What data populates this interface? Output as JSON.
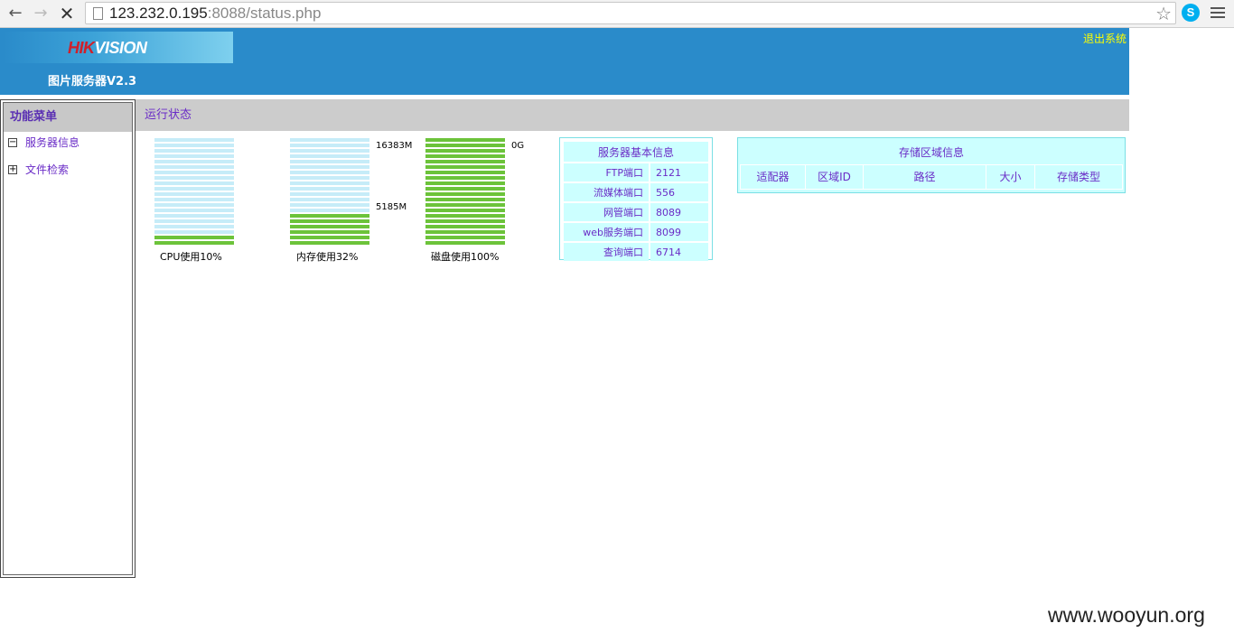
{
  "browser": {
    "url_host": "123.232.0.195",
    "url_port_path": ":8088/status.php"
  },
  "header": {
    "logo_text_hik": "HIK",
    "logo_text_rest": "VISION",
    "app_title": "图片服务器V2.3",
    "logout_label": "退出系统"
  },
  "sidebar": {
    "title": "功能菜单",
    "items": [
      {
        "label": "服务器信息",
        "toggle": "−"
      },
      {
        "label": "文件检索",
        "toggle": "+"
      }
    ]
  },
  "content": {
    "section_title": "运行状态"
  },
  "gauges": {
    "cpu": {
      "label": "CPU使用10%",
      "fraction": 0.1
    },
    "memory": {
      "label": "内存使用32%",
      "fraction": 0.32,
      "total": "16383M",
      "used": "5185M"
    },
    "disk": {
      "label": "磁盘使用100%",
      "fraction": 1.0,
      "total": "0G"
    },
    "colors": {
      "empty": "#c6ecf8",
      "filled": "#6cc33a"
    }
  },
  "server_info": {
    "title": "服务器基本信息",
    "rows": [
      {
        "key": "FTP端口",
        "value": "2121"
      },
      {
        "key": "流媒体端口",
        "value": "556"
      },
      {
        "key": "网管端口",
        "value": "8089"
      },
      {
        "key": "web服务端口",
        "value": "8099"
      },
      {
        "key": "查询端口",
        "value": "6714"
      }
    ]
  },
  "storage_info": {
    "title": "存储区域信息",
    "columns": [
      "适配器",
      "区域ID",
      "路径",
      "大小",
      "存储类型"
    ]
  },
  "watermark": "www.wooyun.org"
}
